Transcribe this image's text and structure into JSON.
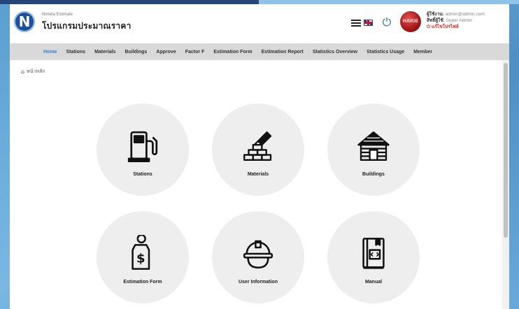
{
  "header": {
    "app_subtitle": "Nimeta Estimate",
    "app_title": "โปรแกรมประมาณราคา",
    "logo_letter": "N",
    "avatar_text": "HAIGE",
    "user": {
      "username_label": "ผู้ใช้งาน:",
      "username_value": "admin@admin.com",
      "role_label": "สิทธิ์ผู้ใช้:",
      "role_value": "Super Admin",
      "edit_profile": "แก้ไขโปรไฟล์"
    }
  },
  "nav": {
    "items": [
      {
        "label": "Home",
        "active": true
      },
      {
        "label": "Stations"
      },
      {
        "label": "Materials"
      },
      {
        "label": "Buildings"
      },
      {
        "label": "Approve"
      },
      {
        "label": "Factor F"
      },
      {
        "label": "Estimation Form"
      },
      {
        "label": "Estimation Report"
      },
      {
        "label": "Statistics Overview"
      },
      {
        "label": "Statistics Usage"
      },
      {
        "label": "Member"
      }
    ]
  },
  "breadcrumb": {
    "home": "หน้าหลัก"
  },
  "tiles": [
    {
      "label": "Stations",
      "icon": "fuel-pump-icon"
    },
    {
      "label": "Materials",
      "icon": "bricks-trowel-icon"
    },
    {
      "label": "Buildings",
      "icon": "log-cabin-icon"
    },
    {
      "label": "Estimation Form",
      "icon": "price-tag-icon"
    },
    {
      "label": "User Information",
      "icon": "hard-hat-icon"
    },
    {
      "label": "Manual",
      "icon": "code-book-icon"
    }
  ],
  "colors": {
    "active_nav": "#2e7fd4",
    "navbar_bg": "#d9d9d9",
    "tile_bg": "#eeeeee",
    "power_icon": "#2f6cc4",
    "logout": "#e02020"
  }
}
